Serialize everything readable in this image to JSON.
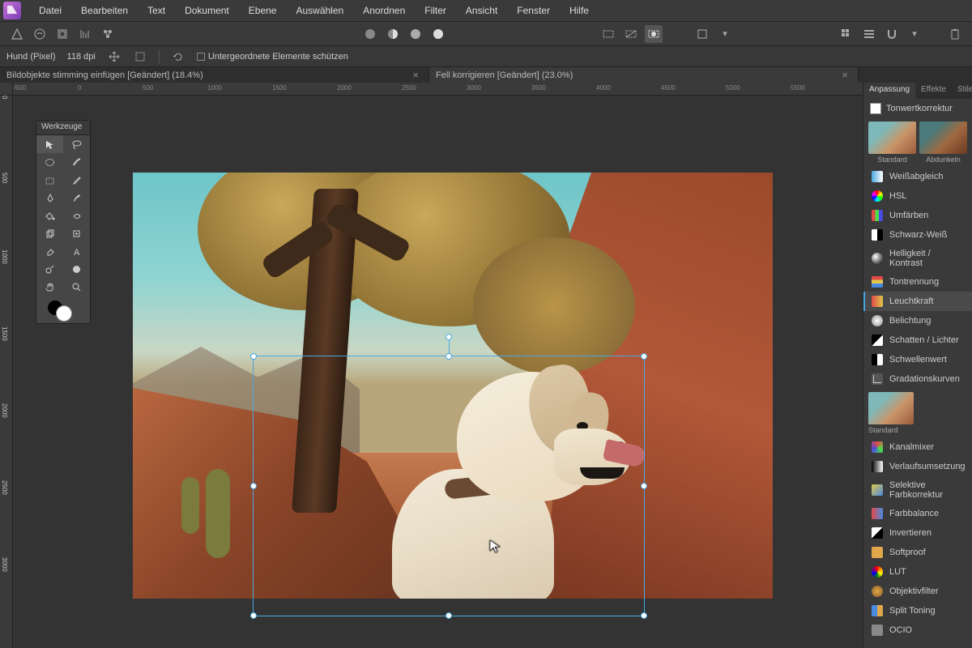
{
  "menu": [
    "Datei",
    "Bearbeiten",
    "Text",
    "Dokument",
    "Ebene",
    "Auswählen",
    "Anordnen",
    "Filter",
    "Ansicht",
    "Fenster",
    "Hilfe"
  ],
  "context": {
    "layer": "Hund (Pixel)",
    "dpi": "118 dpi",
    "protect": "Untergeordnete Elemente schützen"
  },
  "tabs": [
    {
      "title": "Bildobjekte stimming einfügen [Geändert] (18.4%)",
      "active": false
    },
    {
      "title": "Fell korrigieren [Geändert] (23.0%)",
      "active": true
    }
  ],
  "ruler_h": [
    "-500",
    "0",
    "500",
    "1000",
    "1500",
    "2000",
    "2500",
    "3000",
    "3500",
    "4000",
    "4500",
    "5000",
    "5500"
  ],
  "ruler_v": [
    "0",
    "500",
    "1000",
    "1500",
    "2000",
    "2500",
    "3000"
  ],
  "tools_title": "Werkzeuge",
  "panel_tabs": [
    "Anpassung",
    "Effekte",
    "Stile"
  ],
  "adj_header": "Tonwertkorrektur",
  "presets": [
    {
      "label": "Standard",
      "cls": "std"
    },
    {
      "label": "Abdunkeln",
      "cls": "dark"
    }
  ],
  "preset_single": "Standard",
  "adjustments": [
    {
      "label": "Weißabgleich",
      "icon": "ic-wb"
    },
    {
      "label": "HSL",
      "icon": "ic-hsl"
    },
    {
      "label": "Umfärben",
      "icon": "ic-recolor"
    },
    {
      "label": "Schwarz-Weiß",
      "icon": "ic-bw"
    },
    {
      "label": "Helligkeit / Kontrast",
      "icon": "ic-bc"
    },
    {
      "label": "Tontrennung",
      "icon": "ic-post"
    },
    {
      "label": "Leuchtkraft",
      "icon": "ic-vib",
      "selected": true
    },
    {
      "label": "Belichtung",
      "icon": "ic-exp"
    },
    {
      "label": "Schatten / Lichter",
      "icon": "ic-sh"
    },
    {
      "label": "Schwellenwert",
      "icon": "ic-thr"
    },
    {
      "label": "Gradationskurven",
      "icon": "ic-curv"
    }
  ],
  "adjustments2": [
    {
      "label": "Kanalmixer",
      "icon": "ic-chmix"
    },
    {
      "label": "Verlaufsumsetzung",
      "icon": "ic-grad"
    },
    {
      "label": "Selektive Farbkorrektur",
      "icon": "ic-selcol"
    },
    {
      "label": "Farbbalance",
      "icon": "ic-colbal"
    },
    {
      "label": "Invertieren",
      "icon": "ic-inv"
    },
    {
      "label": "Softproof",
      "icon": "ic-soft"
    },
    {
      "label": "LUT",
      "icon": "ic-lut"
    },
    {
      "label": "Objektivfilter",
      "icon": "ic-lens"
    },
    {
      "label": "Split Toning",
      "icon": "ic-split"
    },
    {
      "label": "OCIO",
      "icon": "ic-ocio"
    }
  ]
}
